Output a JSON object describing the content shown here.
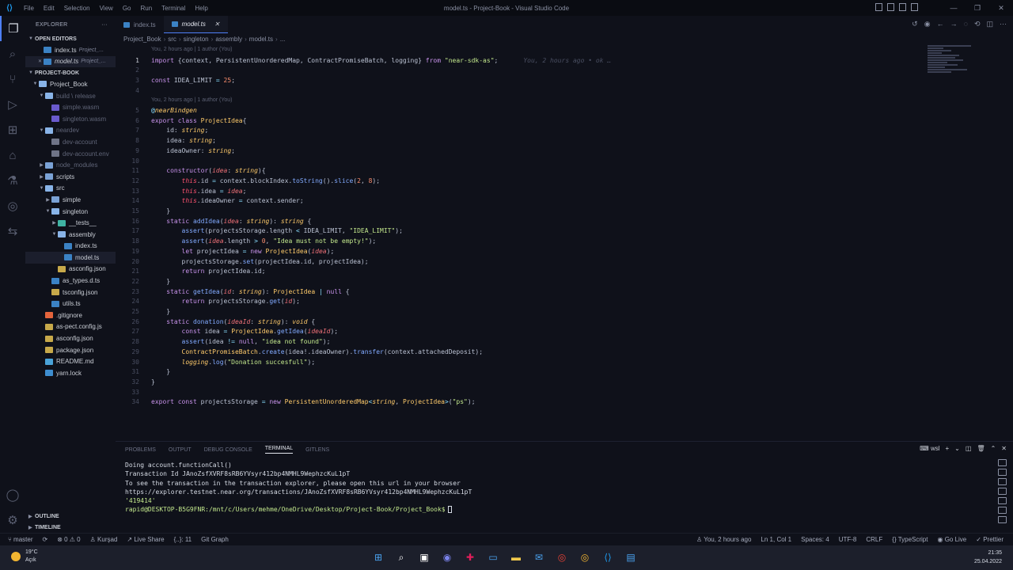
{
  "window": {
    "title": "model.ts - Project-Book - Visual Studio Code",
    "menu": [
      "File",
      "Edit",
      "Selection",
      "View",
      "Go",
      "Run",
      "Terminal",
      "Help"
    ]
  },
  "sidebar": {
    "header": "EXPLORER",
    "open_editors_label": "OPEN EDITORS",
    "open_editors": [
      {
        "name": "index.ts",
        "desc": "Project_..."
      },
      {
        "name": "model.ts",
        "desc": "Project_..."
      }
    ],
    "project_label": "PROJECT-BOOK",
    "tree": [
      {
        "name": "Project_Book",
        "depth": 0,
        "kind": "folder-open",
        "twisty": "v",
        "dim": false
      },
      {
        "name": "build \\ release",
        "depth": 1,
        "kind": "folder-open",
        "twisty": "v",
        "dim": true
      },
      {
        "name": "simple.wasm",
        "depth": 2,
        "kind": "wasm",
        "twisty": "",
        "dim": true
      },
      {
        "name": "singleton.wasm",
        "depth": 2,
        "kind": "wasm",
        "twisty": "",
        "dim": true
      },
      {
        "name": "neardev",
        "depth": 1,
        "kind": "folder-open",
        "twisty": "v",
        "dim": true
      },
      {
        "name": "dev-account",
        "depth": 2,
        "kind": "file",
        "twisty": "",
        "dim": true
      },
      {
        "name": "dev-account.env",
        "depth": 2,
        "kind": "file",
        "twisty": "",
        "dim": true
      },
      {
        "name": "node_modules",
        "depth": 1,
        "kind": "folder",
        "twisty": ">",
        "dim": true
      },
      {
        "name": "scripts",
        "depth": 1,
        "kind": "folder",
        "twisty": ">",
        "dim": false
      },
      {
        "name": "src",
        "depth": 1,
        "kind": "folder-open",
        "twisty": "v",
        "dim": false
      },
      {
        "name": "simple",
        "depth": 2,
        "kind": "folder",
        "twisty": ">",
        "dim": false
      },
      {
        "name": "singleton",
        "depth": 2,
        "kind": "folder-open",
        "twisty": "v",
        "dim": false
      },
      {
        "name": "__tests__",
        "depth": 3,
        "kind": "test",
        "twisty": ">",
        "dim": false
      },
      {
        "name": "assembly",
        "depth": 3,
        "kind": "folder-open",
        "twisty": "v",
        "dim": false
      },
      {
        "name": "index.ts",
        "depth": 4,
        "kind": "ts",
        "twisty": "",
        "dim": false
      },
      {
        "name": "model.ts",
        "depth": 4,
        "kind": "ts",
        "twisty": "",
        "dim": false,
        "selected": true
      },
      {
        "name": "asconfig.json",
        "depth": 3,
        "kind": "json",
        "twisty": "",
        "dim": false
      },
      {
        "name": "as_types.d.ts",
        "depth": 2,
        "kind": "ts",
        "twisty": "",
        "dim": false
      },
      {
        "name": "tsconfig.json",
        "depth": 2,
        "kind": "json",
        "twisty": "",
        "dim": false
      },
      {
        "name": "utils.ts",
        "depth": 2,
        "kind": "ts",
        "twisty": "",
        "dim": false
      },
      {
        "name": ".gitignore",
        "depth": 1,
        "kind": "git",
        "twisty": "",
        "dim": false
      },
      {
        "name": "as-pect.config.js",
        "depth": 1,
        "kind": "json",
        "twisty": "",
        "dim": false
      },
      {
        "name": "asconfig.json",
        "depth": 1,
        "kind": "json",
        "twisty": "",
        "dim": false
      },
      {
        "name": "package.json",
        "depth": 1,
        "kind": "json",
        "twisty": "",
        "dim": false
      },
      {
        "name": "README.md",
        "depth": 1,
        "kind": "md",
        "twisty": "",
        "dim": false
      },
      {
        "name": "yarn.lock",
        "depth": 1,
        "kind": "lock",
        "twisty": "",
        "dim": false
      }
    ],
    "outline_label": "OUTLINE",
    "timeline_label": "TIMELINE"
  },
  "tabs": [
    {
      "label": "index.ts",
      "active": false
    },
    {
      "label": "model.ts",
      "active": true
    }
  ],
  "breadcrumb": [
    "Project_Book",
    "src",
    "singleton",
    "assembly",
    "model.ts",
    "..."
  ],
  "editor": {
    "lens_1": "You, 2 hours ago | 1 author (You)",
    "lens_2": "You, 2 hours ago | 1 author (You)",
    "blame": "You, 2 hours ago • ok …",
    "lines": [
      {
        "n": "1",
        "html": "<span class='kw'>import</span> {context, PersistentUnorderedMap, ContractPromiseBatch, logging} <span class='kw'>from</span> <span class='str'>\"near-sdk-as\"</span>;"
      },
      {
        "n": "2",
        "html": ""
      },
      {
        "n": "3",
        "html": "<span class='kw'>const</span> IDEA_LIMIT <span class='op'>=</span> <span class='num'>25</span>;"
      },
      {
        "n": "4",
        "html": ""
      },
      {
        "n": "5",
        "html": "<span class='op'>@</span><span class='ty-it'>nearBindgen</span>"
      },
      {
        "n": "6",
        "html": "<span class='kw'>export class</span> <span class='tp'>ProjectIdea</span>{"
      },
      {
        "n": "7",
        "html": "    id: <span class='ty-it'>string</span>;"
      },
      {
        "n": "8",
        "html": "    idea: <span class='ty-it'>string</span>;"
      },
      {
        "n": "9",
        "html": "    ideaOwner: <span class='ty-it'>string</span>;"
      },
      {
        "n": "10",
        "html": ""
      },
      {
        "n": "11",
        "html": "    <span class='kw'>constructor</span>(<span class='prm'>idea</span>: <span class='ty-it'>string</span>){"
      },
      {
        "n": "12",
        "html": "        <span class='this'>this</span>.id <span class='op'>=</span> context.blockIndex.<span class='fn'>toString</span>().<span class='fn'>slice</span>(<span class='num'>2</span>, <span class='num'>8</span>);"
      },
      {
        "n": "13",
        "html": "        <span class='this'>this</span>.idea <span class='op'>=</span> <span class='prm'>idea</span>;"
      },
      {
        "n": "14",
        "html": "        <span class='this'>this</span>.ideaOwner <span class='op'>=</span> context.sender;"
      },
      {
        "n": "15",
        "html": "    }"
      },
      {
        "n": "16",
        "html": "    <span class='kw'>static</span> <span class='fn'>addIdea</span>(<span class='prm'>idea</span>: <span class='ty-it'>string</span>): <span class='ty-it'>string</span> {"
      },
      {
        "n": "17",
        "html": "        <span class='fn'>assert</span>(projectsStorage.length <span class='op'>&lt;</span> IDEA_LIMIT, <span class='str'>\"IDEA_LIMIT\"</span>);"
      },
      {
        "n": "18",
        "html": "        <span class='fn'>assert</span>(<span class='prm'>idea</span>.length <span class='op'>&gt;</span> <span class='num'>0</span>, <span class='str'>\"Idea must not be empty!\"</span>);"
      },
      {
        "n": "19",
        "html": "        <span class='kw'>let</span> projectIdea <span class='op'>=</span> <span class='kw'>new</span> <span class='tp'>ProjectIdea</span>(<span class='prm'>idea</span>);"
      },
      {
        "n": "20",
        "html": "        projectsStorage.<span class='fn'>set</span>(projectIdea.id, projectIdea);"
      },
      {
        "n": "21",
        "html": "        <span class='kw'>return</span> projectIdea.id;"
      },
      {
        "n": "22",
        "html": "    }"
      },
      {
        "n": "23",
        "html": "    <span class='kw'>static</span> <span class='fn'>getIdea</span>(<span class='prm'>id</span>: <span class='ty-it'>string</span>): <span class='tp'>ProjectIdea</span> <span class='op'>|</span> <span class='kw'>null</span> {"
      },
      {
        "n": "24",
        "html": "        <span class='kw'>return</span> projectsStorage.<span class='fn'>get</span>(<span class='prm'>id</span>);"
      },
      {
        "n": "25",
        "html": "    }"
      },
      {
        "n": "26",
        "html": "    <span class='kw'>static</span> <span class='fn'>donation</span>(<span class='prm'>ideaId</span>: <span class='ty-it'>string</span>): <span class='ty-it'>void</span> {"
      },
      {
        "n": "27",
        "html": "        <span class='kw'>const</span> idea <span class='op'>=</span> <span class='tp'>ProjectIdea</span>.<span class='fn'>getIdea</span>(<span class='prm'>ideaId</span>);"
      },
      {
        "n": "28",
        "html": "        <span class='fn'>assert</span>(idea <span class='op'>!=</span> <span class='kw'>null</span>, <span class='str'>\"idea not found\"</span>);"
      },
      {
        "n": "29",
        "html": "        <span class='tp'>ContractPromiseBatch</span>.<span class='fn'>create</span>(idea!.ideaOwner).<span class='fn'>transfer</span>(context.attachedDeposit);"
      },
      {
        "n": "30",
        "html": "        <span class='ty-it'>logging</span>.<span class='fn'>log</span>(<span class='str'>\"Donation succesfull\"</span>);"
      },
      {
        "n": "31",
        "html": "    }"
      },
      {
        "n": "32",
        "html": "}"
      },
      {
        "n": "33",
        "html": ""
      },
      {
        "n": "34",
        "html": "<span class='kw'>export const</span> projectsStorage <span class='op'>=</span> <span class='kw'>new</span> <span class='tp'>PersistentUnorderedMap</span><span class='op'>&lt;</span><span class='ty-it'>string</span>, <span class='tp'>ProjectIdea</span><span class='op'>&gt;</span>(<span class='str'>\"ps\"</span>);"
      }
    ]
  },
  "panel": {
    "tabs": [
      "PROBLEMS",
      "OUTPUT",
      "DEBUG CONSOLE",
      "TERMINAL",
      "GITLENS"
    ],
    "active_tab": "TERMINAL",
    "shell_label": "wsl",
    "terminal_lines": [
      "Doing account.functionCall()",
      "Transaction Id JAnoZsfXVRF8sRB6YVsyr412bp4NMHL9WephzcKuL1pT",
      "To see the transaction in the transaction explorer, please open this url in your browser",
      "https://explorer.testnet.near.org/transactions/JAnoZsfXVRF8sRB6YVsyr412bp4NMHL9WephzcKuL1pT"
    ],
    "terminal_value": "'419414'",
    "prompt": "rapid@DESKTOP-B5G9FNR:/mnt/c/Users/mehme/OneDrive/Desktop/Project-Book/Project_Book$"
  },
  "statusbar": {
    "branch": "master",
    "sync": "⟳",
    "problems": "⊗ 0 ⚠ 0",
    "user": "Kurşad",
    "live_share": "Live Share",
    "braces": "{..}: 11",
    "git_graph": "Git Graph",
    "blame": "You, 2 hours ago",
    "position": "Ln 1, Col 1",
    "spaces": "Spaces: 4",
    "encoding": "UTF-8",
    "eol": "CRLF",
    "language": "TypeScript",
    "go_live": "Go Live",
    "prettier": "Prettier"
  },
  "taskbar": {
    "temp": "19°C",
    "condition": "Açık",
    "time": "21:35",
    "date": "25.04.2022"
  },
  "colors": {
    "background": "#0f111a",
    "accent": "#4e7ff7",
    "keyword": "#c792ea",
    "string": "#c3e88d",
    "type": "#ffcb6b"
  }
}
